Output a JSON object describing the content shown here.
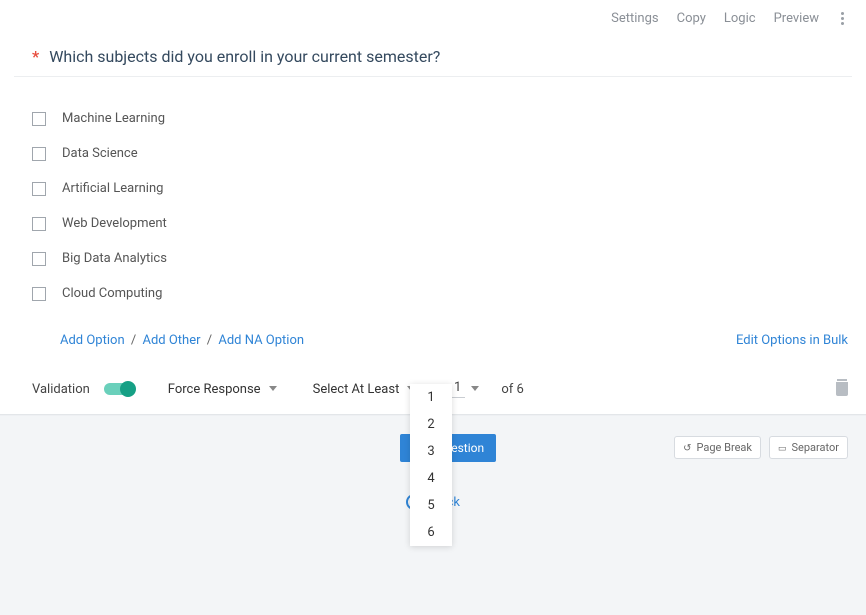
{
  "header": {
    "settings": "Settings",
    "copy": "Copy",
    "logic": "Logic",
    "preview": "Preview"
  },
  "question": {
    "required_mark": "*",
    "text": "Which subjects did you enroll in your current semester?"
  },
  "options": [
    {
      "label": "Machine Learning"
    },
    {
      "label": "Data Science"
    },
    {
      "label": "Artificial Learning"
    },
    {
      "label": "Web Development"
    },
    {
      "label": "Big Data Analytics"
    },
    {
      "label": "Cloud  Computing"
    }
  ],
  "add_links": {
    "add_option": "Add Option",
    "add_other": "Add Other",
    "add_na": "Add NA Option",
    "edit_bulk": "Edit Options in Bulk"
  },
  "validation": {
    "label": "Validation",
    "mode": "Force Response",
    "condition": "Select At Least",
    "selected": "1",
    "of_total": "of 6"
  },
  "dropdown_values": [
    "1",
    "2",
    "3",
    "4",
    "5",
    "6"
  ],
  "footer": {
    "primary_button": "Add Question",
    "page_break": "Page Break",
    "separator": "Separator",
    "center_link": "Block"
  }
}
